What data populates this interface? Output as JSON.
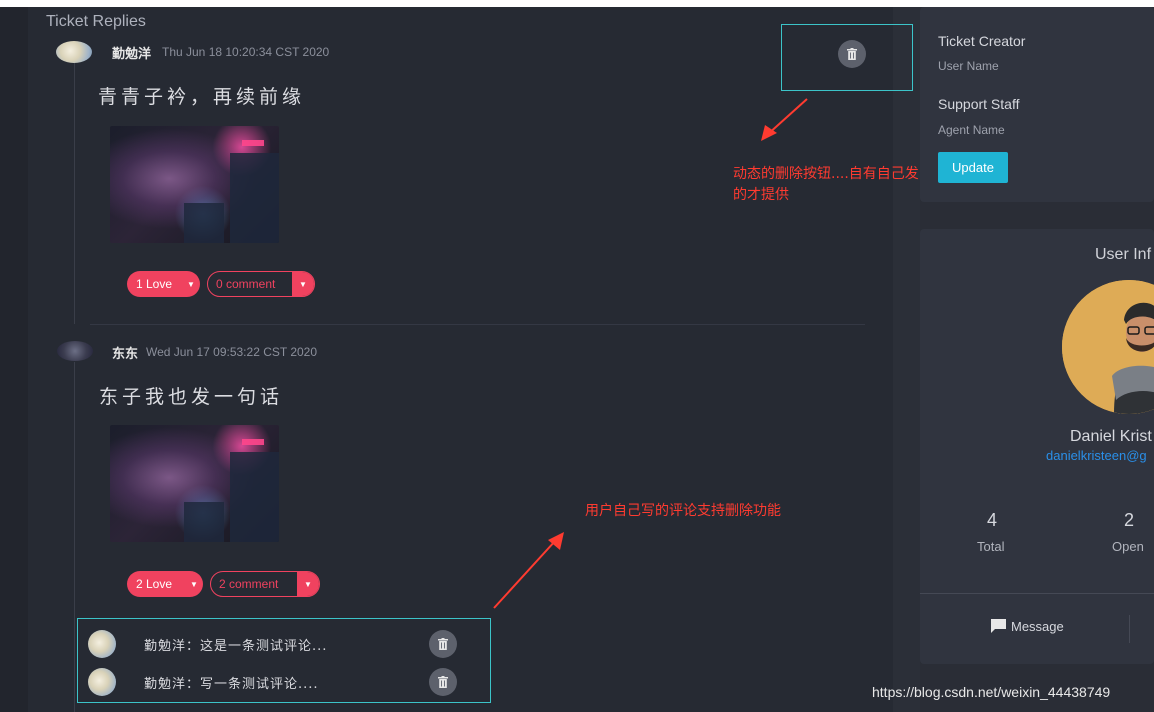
{
  "section_title": "Ticket Replies",
  "posts": [
    {
      "author": "勤勉洋",
      "timestamp": "Thu Jun 18 10:20:34 CST 2020",
      "text": "青青子衿，再续前缘",
      "love_label": "1 Love",
      "comment_label": "0 comment"
    },
    {
      "author": "东东",
      "timestamp": "Wed Jun 17 09:53:22 CST 2020",
      "text": "东子我也发一句话",
      "love_label": "2 Love",
      "comment_label": "2 comment"
    }
  ],
  "comments": [
    {
      "text": "勤勉洋：这是一条测试评论..."
    },
    {
      "text": "勤勉洋：写一条测试评论...."
    }
  ],
  "annotations": {
    "delete_button_note_line1": "动态的删除按钮....自有自己发",
    "delete_button_note_line2": "的才提供",
    "comment_delete_note": "用户自己写的评论支持删除功能"
  },
  "ticket_card": {
    "creator_label": "Ticket Creator",
    "creator_value": "User Name",
    "staff_label": "Support Staff",
    "staff_value": "Agent Name",
    "update_label": "Update"
  },
  "user_card": {
    "title": "User Inf",
    "name": "Daniel Krist",
    "email": "danielkristeen@g",
    "stats": [
      {
        "value": "4",
        "label": "Total"
      },
      {
        "value": "2",
        "label": "Open"
      }
    ],
    "message_label": "Message"
  },
  "watermark": "https://blog.csdn.net/weixin_44438749",
  "colors": {
    "accent_pink": "#f0425f",
    "accent_cyan": "#1fb4d4",
    "annotation_red": "#ff3b30",
    "highlight_border": "#3cc4c9"
  }
}
